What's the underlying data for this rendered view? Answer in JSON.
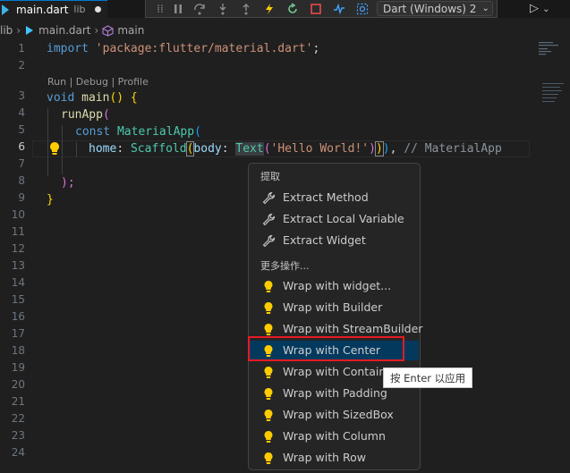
{
  "tab": {
    "filename": "main.dart",
    "folder": "lib",
    "icon": "dart-file-icon"
  },
  "debug_toolbar": {
    "icons": [
      "drag-handle-icon",
      "pause-icon",
      "step-over-icon",
      "step-into-icon",
      "step-out-icon",
      "hot-reload-icon",
      "restart-icon",
      "stop-icon",
      "devtools-icon",
      "inspector-icon"
    ],
    "session": "Dart (Windows) 2"
  },
  "breadcrumb": {
    "folder": "lib",
    "file": "main.dart",
    "symbol": "main"
  },
  "editor": {
    "line_numbers": [
      "1",
      "2",
      "3",
      "4",
      "5",
      "6",
      "7",
      "8",
      "9",
      "10",
      "11",
      "12",
      "13",
      "14",
      "15",
      "16",
      "17",
      "18",
      "19",
      "20",
      "21",
      "22",
      "23",
      "24"
    ],
    "active_line": "6",
    "codelens": "Run | Debug | Profile",
    "code": {
      "l1_kw": "import",
      "l1_str": "'package:flutter/material.dart'",
      "l1_semi": ";",
      "l3_kw": "void",
      "l3_fn": "main",
      "l3_rest": "() {",
      "l4_fn": "runApp",
      "l4_p": "(",
      "l5_kw": "const",
      "l5_cls": "MaterialApp",
      "l5_p": "(",
      "l6_home": "home",
      "l6_colon": ": ",
      "l6_scaffold": "Scaffold",
      "l6_p1": "(",
      "l6_body": "body",
      "l6_colon2": ": ",
      "l6_text": "Text",
      "l6_p2": "(",
      "l6_str": "'Hello World!'",
      "l6_p3": ")",
      "l6_p4": ")",
      "l6_p5": ")",
      "l6_comma": ", ",
      "l6_comment": "// MaterialApp",
      "l7": ");",
      "l8": "}"
    }
  },
  "context_menu": {
    "section_extract": "提取",
    "extract_items": [
      {
        "label": "Extract Method",
        "icon": "wrench-icon"
      },
      {
        "label": "Extract Local Variable",
        "icon": "wrench-icon"
      },
      {
        "label": "Extract Widget",
        "icon": "wrench-icon"
      }
    ],
    "section_more": "更多操作...",
    "more_items": [
      {
        "label": "Wrap with widget...",
        "icon": "lightbulb-icon"
      },
      {
        "label": "Wrap with Builder",
        "icon": "lightbulb-icon"
      },
      {
        "label": "Wrap with StreamBuilder",
        "icon": "lightbulb-icon"
      },
      {
        "label": "Wrap with Center",
        "icon": "lightbulb-icon",
        "selected": true
      },
      {
        "label": "Wrap with Container",
        "icon": "lightbulb-icon"
      },
      {
        "label": "Wrap with Padding",
        "icon": "lightbulb-icon"
      },
      {
        "label": "Wrap with SizedBox",
        "icon": "lightbulb-icon"
      },
      {
        "label": "Wrap with Column",
        "icon": "lightbulb-icon"
      },
      {
        "label": "Wrap with Row",
        "icon": "lightbulb-icon"
      }
    ]
  },
  "tooltip": "按 Enter 以应用",
  "colors": {
    "accent": "#0078d4",
    "selection": "#04395e",
    "highlight_box": "#e51b24",
    "bulb": "#ffcc00"
  }
}
